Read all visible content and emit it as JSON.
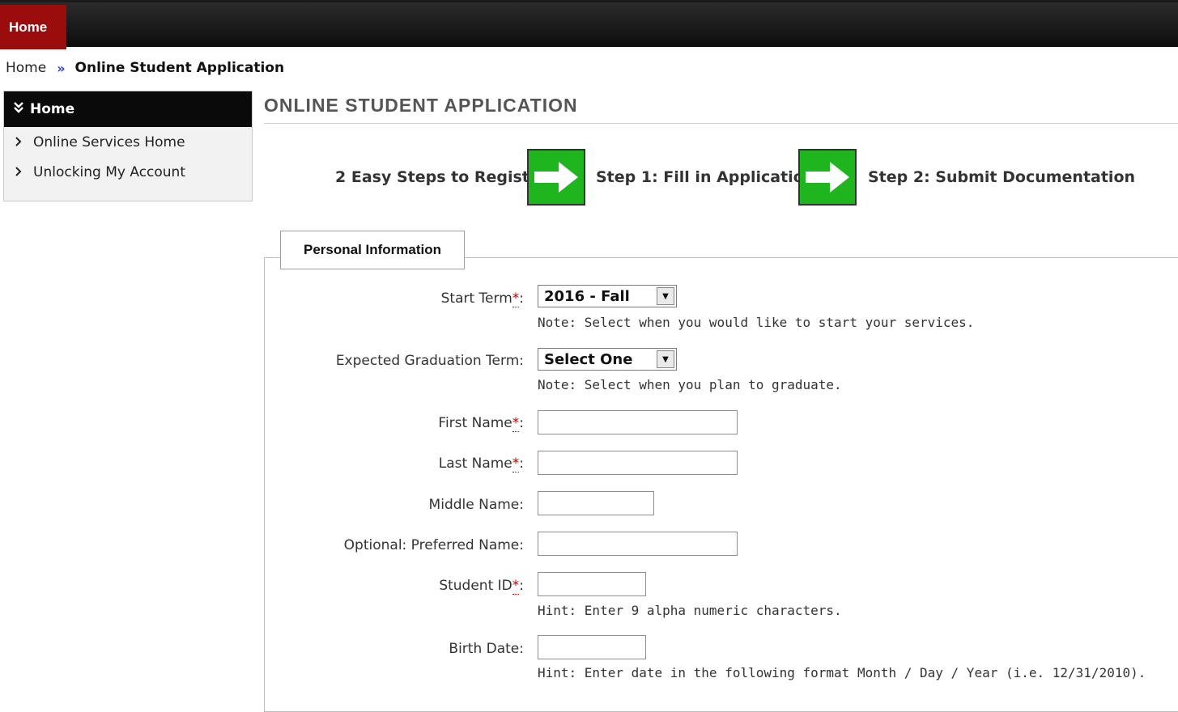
{
  "nav": {
    "home_tab": "Home"
  },
  "breadcrumb": {
    "home": "Home",
    "separator": "»",
    "current": "Online Student Application"
  },
  "sidebar": {
    "header": "Home",
    "header_icon": "double-chevron-down-icon",
    "items": [
      {
        "label": "Online Services Home",
        "icon": "chevron-right-icon"
      },
      {
        "label": "Unlocking My Account",
        "icon": "chevron-right-icon"
      }
    ]
  },
  "main": {
    "title": "ONLINE STUDENT APPLICATION",
    "steps": {
      "intro": "2 Easy Steps to Register",
      "step1": "Step 1: Fill in Application",
      "step2": "Step 2: Submit Documentation",
      "arrow_icon": "green-arrow-right-icon"
    }
  },
  "form": {
    "legend": "Personal Information",
    "required_marker": "*",
    "start_term": {
      "label": "Start Term",
      "value": "2016 - Fall",
      "note": "Note: Select when you would like to start your services."
    },
    "grad_term": {
      "label": "Expected Graduation Term:",
      "value": "Select One",
      "note": "Note: Select when you plan to graduate."
    },
    "first_name": {
      "label": "First Name",
      "value": ""
    },
    "last_name": {
      "label": "Last Name",
      "value": ""
    },
    "middle_name": {
      "label": "Middle Name:",
      "value": ""
    },
    "preferred_name": {
      "label": "Optional: Preferred Name:",
      "value": ""
    },
    "student_id": {
      "label": "Student ID",
      "value": "",
      "hint": "Hint: Enter 9 alpha numeric characters."
    },
    "birth_date": {
      "label": "Birth Date:",
      "value": "",
      "hint": "Hint: Enter date in the following format Month / Day / Year (i.e. 12/31/2010)."
    }
  },
  "colors": {
    "nav_bar": "#111111",
    "home_tab": "#9b0d0d",
    "arrow_green": "#1fb51f",
    "required": "#c00000",
    "breadcrumb_sep": "#2b3fd0"
  }
}
